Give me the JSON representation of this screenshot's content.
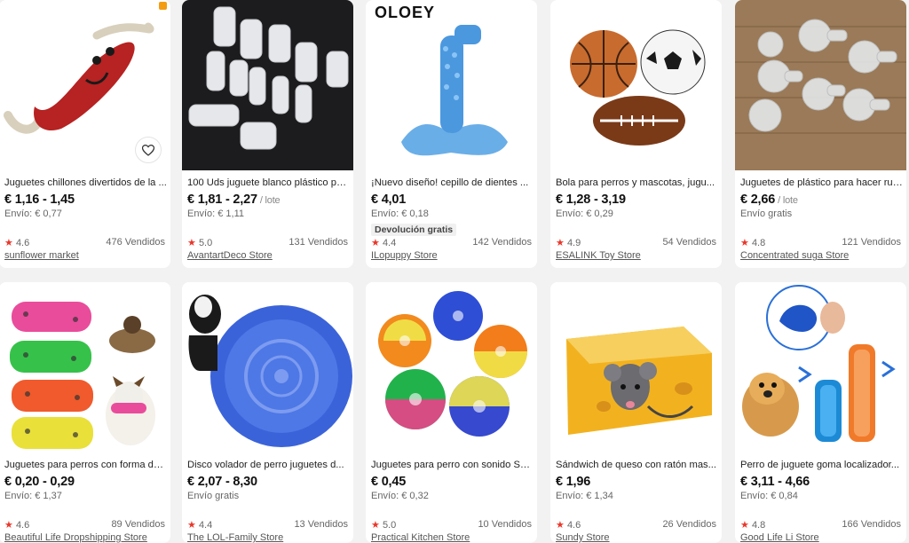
{
  "products": [
    {
      "title": "Juguetes chillones divertidos de la ...",
      "price": "€ 1,16 - 1,45",
      "unit": "",
      "shipping": "Envío: € 0,77",
      "badge": "",
      "rating": "4.6",
      "sold": "476 Vendidos",
      "store": "sunflower market"
    },
    {
      "title": "100 Uds juguete blanco plástico pe...",
      "price": "€ 1,81 - 2,27",
      "unit": "/ lote",
      "shipping": "Envío: € 1,11",
      "badge": "",
      "rating": "5.0",
      "sold": "131 Vendidos",
      "store": "AvantartDeco Store"
    },
    {
      "title": "¡Nuevo diseño! cepillo de dientes ...",
      "price": "€ 4,01",
      "unit": "",
      "shipping": "Envío: € 0,18",
      "badge": "Devolución gratis",
      "rating": "4.4",
      "sold": "142 Vendidos",
      "store": "ILopuppy Store",
      "brand": "OLOEY"
    },
    {
      "title": "Bola para perros y mascotas, jugu...",
      "price": "€ 1,28 - 3,19",
      "unit": "",
      "shipping": "Envío: € 0,29",
      "badge": "",
      "rating": "4.9",
      "sold": "54 Vendidos",
      "store": "ESALINK Toy Store"
    },
    {
      "title": "Juguetes de plástico para hacer rui...",
      "price": "€ 2,66",
      "unit": "/ lote",
      "shipping": "Envío gratis",
      "badge": "",
      "rating": "4.8",
      "sold": "121 Vendidos",
      "store": "Concentrated suga Store"
    },
    {
      "title": "Juguetes para perros con forma de...",
      "price": "€ 0,20 - 0,29",
      "unit": "",
      "shipping": "Envío: € 1,37",
      "badge": "",
      "rating": "4.6",
      "sold": "89 Vendidos",
      "store": "Beautiful Life Dropshipping Store"
    },
    {
      "title": "Disco volador de perro juguetes d...",
      "price": "€ 2,07 - 8,30",
      "unit": "",
      "shipping": "Envío gratis",
      "badge": "",
      "rating": "4.4",
      "sold": "13 Vendidos",
      "store": "The LOL-Family Store"
    },
    {
      "title": "Juguetes para perro con sonido Sq...",
      "price": "€ 0,45",
      "unit": "",
      "shipping": "Envío: € 0,32",
      "badge": "",
      "rating": "5.0",
      "sold": "10 Vendidos",
      "store": "Practical Kitchen Store"
    },
    {
      "title": "Sándwich de queso con ratón mas...",
      "price": "€ 1,96",
      "unit": "",
      "shipping": "Envío: € 1,34",
      "badge": "",
      "rating": "4.6",
      "sold": "26 Vendidos",
      "store": "Sundy Store"
    },
    {
      "title": "Perro de juguete goma localizador...",
      "price": "€ 3,11 - 4,66",
      "unit": "",
      "shipping": "Envío: € 0,84",
      "badge": "",
      "rating": "4.8",
      "sold": "166 Vendidos",
      "store": "Good Life Li Store"
    }
  ],
  "icons": {
    "star": "star-icon",
    "wishlist": "heart-icon"
  },
  "colors": {
    "star": "#e9372b",
    "background": "#f2f2f2",
    "card": "#ffffff"
  }
}
